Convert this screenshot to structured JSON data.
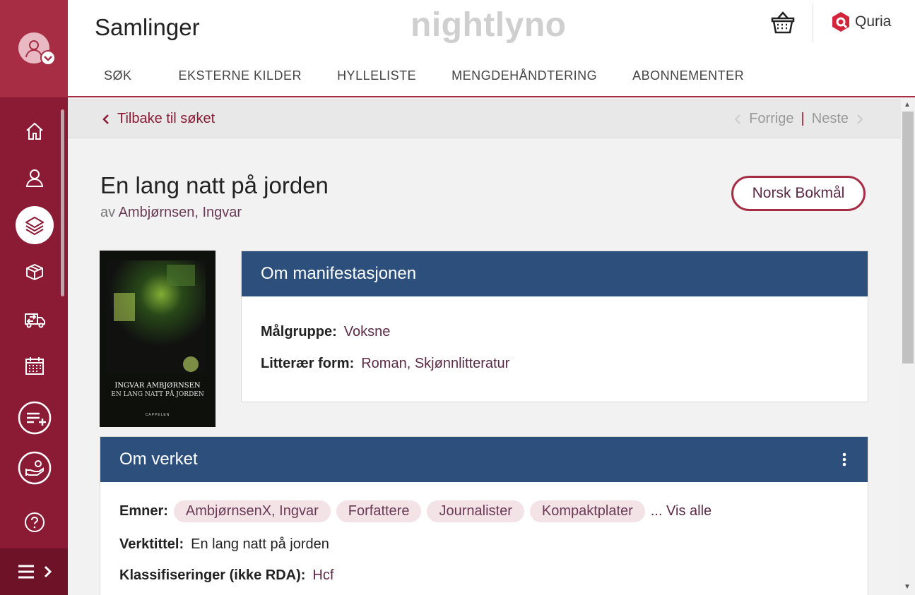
{
  "header": {
    "title": "Samlinger",
    "brand": "nightlyno",
    "quria_label": "Quria",
    "nav": [
      "SØK",
      "EKSTERNE KILDER",
      "HYLLELISTE",
      "MENGDEHÅNDTERING",
      "ABONNEMENTER"
    ]
  },
  "subbar": {
    "back_label": "Tilbake til søket",
    "prev_label": "Forrige",
    "separator": "|",
    "next_label": "Neste"
  },
  "record": {
    "title": "En lang natt på jorden",
    "by_prefix": "av",
    "author": "Ambjørnsen, Ingvar",
    "language_button": "Norsk Bokmål",
    "cover": {
      "author": "INGVAR AMBJØRNSEN",
      "title": "EN LANG NATT PÅ JORDEN",
      "publisher": "CAPPELEN"
    }
  },
  "manifestation": {
    "heading": "Om manifestasjonen",
    "target_label": "Målgruppe:",
    "target_value": "Voksne",
    "form_label": "Litterær form:",
    "form_value": "Roman, Skjønnlitteratur"
  },
  "work": {
    "heading": "Om verket",
    "subjects_label": "Emner:",
    "subjects": [
      "AmbjørnsenX, Ingvar",
      "Forfattere",
      "Journalister",
      "Kompaktplater"
    ],
    "show_all": "... Vis alle",
    "work_title_label": "Verktittel:",
    "work_title_value": "En lang natt på jorden",
    "class_label": "Klassifiseringer (ikke RDA):",
    "class_value": "Hcf"
  },
  "colors": {
    "rail": "#8b1a35",
    "rail_top": "#a72d44",
    "card_header": "#2c4f7c",
    "accent": "#a72d44"
  }
}
